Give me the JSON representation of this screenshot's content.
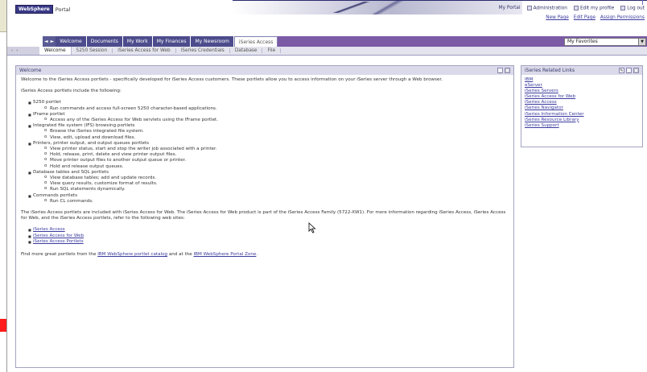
{
  "banner": {
    "logo_badge": "WebSphere",
    "logo_word": "Portal",
    "util_links": [
      "My Portal",
      "Administration",
      "Edit my profile",
      "Log out"
    ],
    "page_links": [
      "New Page",
      "Edit Page",
      "Assign Permissions"
    ]
  },
  "nav": {
    "arrows": [
      "◄",
      "►"
    ],
    "tabs": [
      "Welcome",
      "Documents",
      "My Work",
      "My Finances",
      "My Newsroom",
      "iSeries Access"
    ],
    "active_tab": "iSeries Access",
    "favorites": {
      "selected": "My Favorites"
    }
  },
  "subnav": {
    "lead": [
      "‹",
      "›"
    ],
    "tabs": [
      "Welcome",
      "5250 Session",
      "iSeries Access for Web",
      "iSeries Credentials",
      "Database",
      "File"
    ],
    "active": "Welcome"
  },
  "welcome_portlet": {
    "title": "Welcome",
    "intro": "Welcome to the iSeries Access portlets - specifically developed for iSeries Access customers. These portlets allow you to access information on your iSeries server through a Web browser.",
    "include_heading": "iSeries Access portlets include the following:",
    "items": [
      {
        "label": "5250 portlet",
        "subs": [
          "Run commands and access full-screen 5250 character-based applications."
        ]
      },
      {
        "label": "IFrame portlet",
        "subs": [
          "Access any of the iSeries Access for Web servlets using the IFrame portlet."
        ]
      },
      {
        "label": "Integrated file system (IFS) browsing portlets",
        "subs": [
          "Browse the iSeries integrated file system.",
          "View, edit, upload and download files."
        ]
      },
      {
        "label": "Printers, printer output, and output queues portlets",
        "subs": [
          "View printer status, start and stop the writer job associated with a printer.",
          "Hold, release, print, delete and view printer output files.",
          "Move printer output files to another output queue or printer.",
          "Hold and release output queues."
        ]
      },
      {
        "label": "Database tables and SQL portlets",
        "subs": [
          "View database tables; add and update records.",
          "View query results, customize format of results.",
          "Run SQL statements dynamically."
        ]
      },
      {
        "label": "Commands portlets",
        "subs": [
          "Run CL commands."
        ]
      }
    ],
    "outro": "The iSeries Access portlets are included with iSeries Access for Web. The iSeries Access for Web product is part of the iSeries Access Family (5722-XW1). For more information regarding iSeries Access, iSeries Access for Web, and the iSeries Access portlets, refer to the following web sites:",
    "links": [
      "iSeries Access",
      "iSeries Access for Web",
      "iSeries Access Portlets"
    ],
    "footer_pre": "Find more great portlets from the ",
    "footer_link1": "IBM WebSphere portlet catalog",
    "footer_mid": " and at the ",
    "footer_link2": "IBM WebSphere Portal Zone",
    "footer_post": "."
  },
  "related_portlet": {
    "title": "iSeries Related Links",
    "links": [
      "IBM",
      "eServer",
      "iSeries Servers",
      "iSeries Access for Web",
      "iSeries Access",
      "iSeries Navigator",
      "iSeries Information Center",
      "iSeries Resource Library",
      "iSeries Support"
    ]
  }
}
